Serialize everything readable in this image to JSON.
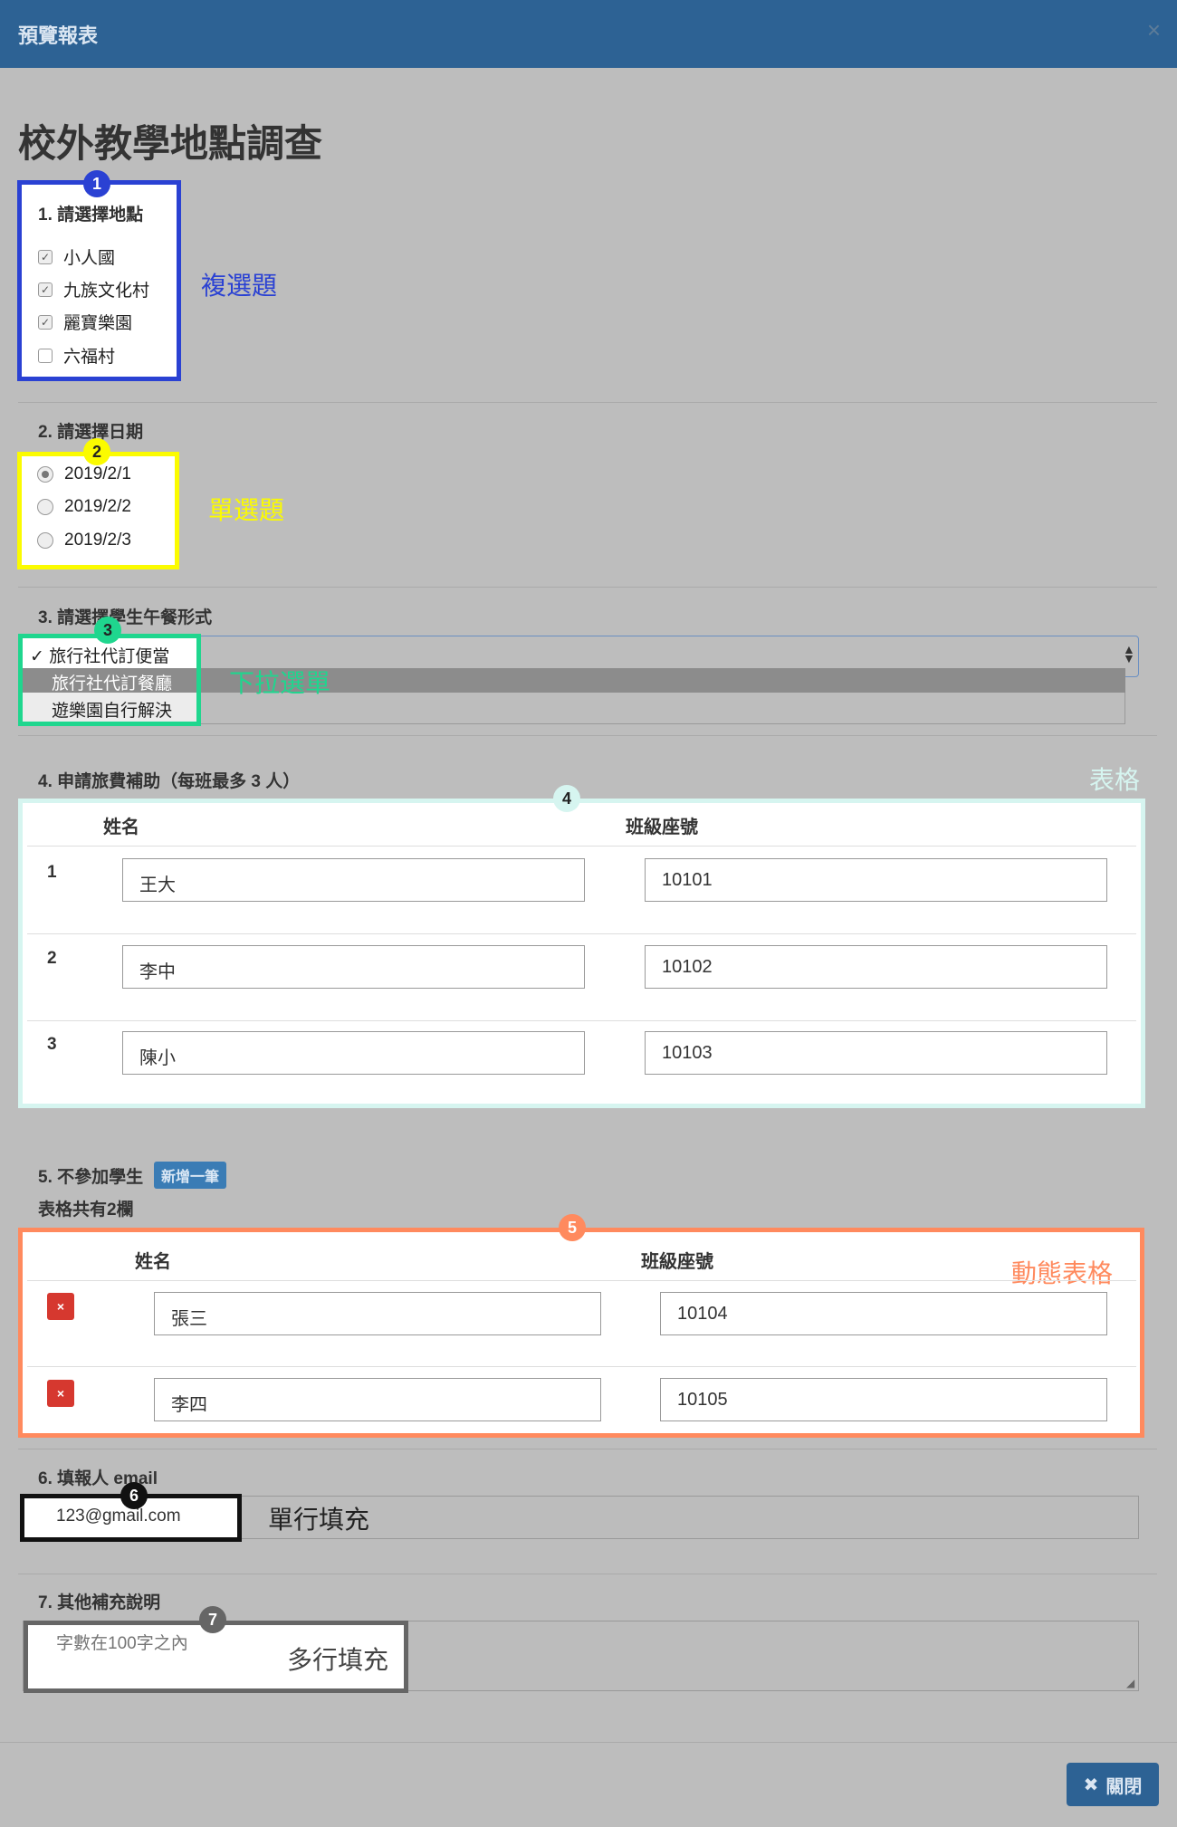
{
  "dialog": {
    "title": "預覽報表",
    "close_glyph": "×"
  },
  "form_title": "校外教學地點調查",
  "q1": {
    "label": "1. 請選擇地點",
    "options": [
      {
        "label": "小人國",
        "checked": true
      },
      {
        "label": "九族文化村",
        "checked": true
      },
      {
        "label": "麗寶樂園",
        "checked": true
      },
      {
        "label": "六福村",
        "checked": false
      }
    ]
  },
  "q2": {
    "label": "2. 請選擇日期",
    "options": [
      {
        "label": "2019/2/1",
        "selected": true
      },
      {
        "label": "2019/2/2",
        "selected": false
      },
      {
        "label": "2019/2/3",
        "selected": false
      }
    ]
  },
  "q3": {
    "label": "3. 請選擇學生午餐形式",
    "options": [
      "旅行社代訂便當",
      "旅行社代訂餐廳",
      "遊樂園自行解決"
    ],
    "selected_index": 0,
    "highlighted_index": 1
  },
  "q4": {
    "label": "4. 申請旅費補助（每班最多 3 人）",
    "headers": [
      "姓名",
      "班級座號"
    ],
    "rows": [
      {
        "num": "1",
        "name": "王大",
        "id": "10101"
      },
      {
        "num": "2",
        "name": "李中",
        "id": "10102"
      },
      {
        "num": "3",
        "name": "陳小",
        "id": "10103"
      }
    ]
  },
  "q5": {
    "label": "5. 不參加學生",
    "add_button": "新增一筆",
    "summary": "表格共有2欄",
    "headers": [
      "姓名",
      "班級座號"
    ],
    "delete_glyph": "×",
    "rows": [
      {
        "name": "張三",
        "id": "10104"
      },
      {
        "name": "李四",
        "id": "10105"
      }
    ]
  },
  "q6": {
    "label": "6. 填報人 email",
    "value": "123@gmail.com"
  },
  "q7": {
    "label": "7. 其他補充說明",
    "placeholder": "字數在100字之內"
  },
  "footer": {
    "close_icon": "✖",
    "close_label": "關閉"
  },
  "annotations": {
    "badges": [
      "1",
      "2",
      "3",
      "4",
      "5",
      "6",
      "7"
    ],
    "notes": [
      "複選題",
      "單選題",
      "下拉選單",
      "表格",
      "動態表格",
      "單行填充",
      "多行填充"
    ],
    "colors": {
      "1": "#2a41d3",
      "2": "#fbfb00",
      "3": "#1fd68e",
      "4": "#d6f5f0",
      "5": "#ff8a5e",
      "6": "#111111",
      "7": "#666666"
    }
  }
}
